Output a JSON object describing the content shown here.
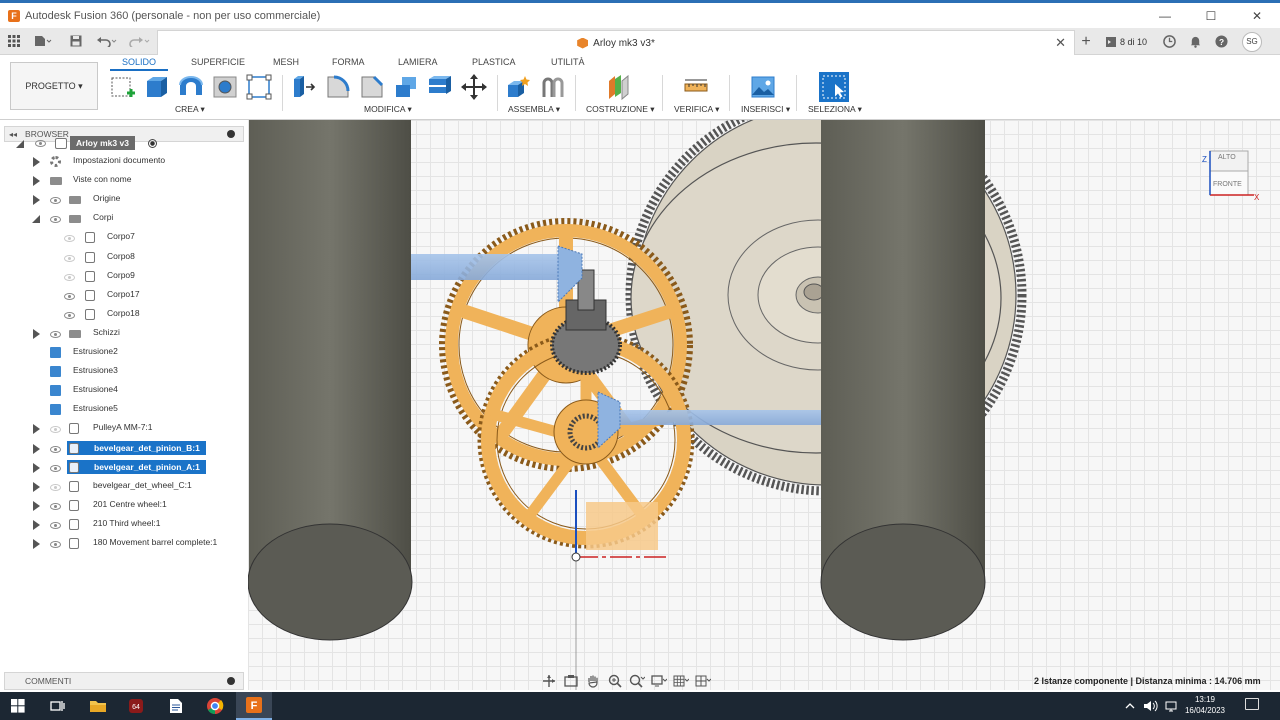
{
  "window": {
    "title": "Autodesk Fusion 360 (personale - non per uso commerciale)",
    "minimize": "—",
    "maximize": "☐",
    "close": "✕"
  },
  "doc_tab": {
    "title": "Arloy mk3 v3*",
    "close": "✕",
    "add": "+",
    "counter": "8 di 10",
    "avatar": "SG"
  },
  "ribbon": {
    "project_label": "PROGETTO ▾",
    "tabs": [
      "SOLIDO",
      "SUPERFICIE",
      "MESH",
      "FORMA",
      "LAMIERA",
      "PLASTICA",
      "UTILITÀ"
    ],
    "active_tab": "SOLIDO",
    "groups": {
      "crea": "CREA ▾",
      "modifica": "MODIFICA ▾",
      "assembla": "ASSEMBLA ▾",
      "costruzione": "COSTRUZIONE ▾",
      "verifica": "VERIFICA ▾",
      "inserisci": "INSERISCI ▾",
      "seleziona": "SELEZIONA ▾"
    }
  },
  "browser": {
    "title": "BROWSER",
    "root": "Arloy mk3 v3",
    "items": [
      {
        "label": "Impostazioni documento",
        "type": "settings",
        "depth": 1,
        "expander": "closed",
        "eye": "none"
      },
      {
        "label": "Viste con nome",
        "type": "folder",
        "depth": 1,
        "expander": "closed",
        "eye": "none"
      },
      {
        "label": "Origine",
        "type": "folder",
        "depth": 1,
        "expander": "closed",
        "eye": "on"
      },
      {
        "label": "Corpi",
        "type": "folder",
        "depth": 1,
        "expander": "open",
        "eye": "on"
      },
      {
        "label": "Corpo7",
        "type": "body",
        "depth": 2,
        "expander": "none",
        "eye": "off"
      },
      {
        "label": "Corpo8",
        "type": "body",
        "depth": 2,
        "expander": "none",
        "eye": "off"
      },
      {
        "label": "Corpo9",
        "type": "body",
        "depth": 2,
        "expander": "none",
        "eye": "off"
      },
      {
        "label": "Corpo17",
        "type": "body",
        "depth": 2,
        "expander": "none",
        "eye": "on"
      },
      {
        "label": "Corpo18",
        "type": "body",
        "depth": 2,
        "expander": "none",
        "eye": "on"
      },
      {
        "label": "Schizzi",
        "type": "folder",
        "depth": 1,
        "expander": "closed",
        "eye": "on"
      },
      {
        "label": "Estrusione2",
        "type": "extrude",
        "depth": 0,
        "expander": "none",
        "eye": "none"
      },
      {
        "label": "Estrusione3",
        "type": "extrude",
        "depth": 0,
        "expander": "none",
        "eye": "none"
      },
      {
        "label": "Estrusione4",
        "type": "extrude",
        "depth": 0,
        "expander": "none",
        "eye": "none"
      },
      {
        "label": "Estrusione5",
        "type": "extrude",
        "depth": 0,
        "expander": "none",
        "eye": "none"
      },
      {
        "label": "PulleyA MM-7:1",
        "type": "component",
        "depth": 1,
        "expander": "closed",
        "eye": "off"
      },
      {
        "label": "bevelgear_det_pinion_B:1",
        "type": "component",
        "depth": 1,
        "expander": "closed",
        "eye": "on",
        "selected": true
      },
      {
        "label": "bevelgear_det_pinion_A:1",
        "type": "component",
        "depth": 1,
        "expander": "closed",
        "eye": "on",
        "selected": true
      },
      {
        "label": "bevelgear_det_wheel_C:1",
        "type": "component",
        "depth": 1,
        "expander": "closed",
        "eye": "off"
      },
      {
        "label": "201 Centre wheel:1",
        "type": "component",
        "depth": 1,
        "expander": "closed",
        "eye": "on"
      },
      {
        "label": "210 Third wheel:1",
        "type": "component",
        "depth": 1,
        "expander": "closed",
        "eye": "on"
      },
      {
        "label": "180 Movement barrel complete:1",
        "type": "component",
        "depth": 1,
        "expander": "closed",
        "eye": "on"
      }
    ],
    "comments": "COMMENTI"
  },
  "viewcube": {
    "top": "ALTO",
    "front": "FRONTE",
    "z": "Z",
    "x": "X"
  },
  "status": "2 Istanze componente | Distanza minima : 14.706 mm",
  "taskbar": {
    "time": "13:19",
    "date": "16/04/2023"
  },
  "colors": {
    "accent": "#1a73c8",
    "gear": "#f0b35a",
    "gear_edge": "#8a5a1a",
    "pillar": "#6a6a5f",
    "barrel": "#dcd6c8",
    "bevel": "#8fb3e0"
  }
}
